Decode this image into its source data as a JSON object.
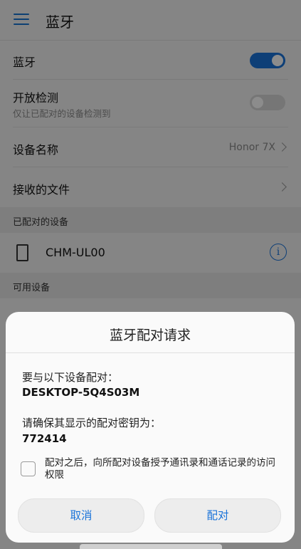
{
  "header": {
    "title": "蓝牙"
  },
  "settings": {
    "bluetooth": {
      "label": "蓝牙",
      "enabled": true
    },
    "discoverable": {
      "label": "开放检测",
      "subtitle": "仅让已配对的设备检测到",
      "enabled": false
    },
    "device_name": {
      "label": "设备名称",
      "value": "Honor 7X"
    },
    "received_files": {
      "label": "接收的文件"
    }
  },
  "paired_devices": {
    "header": "已配对的设备",
    "items": [
      {
        "name": "CHM-UL00"
      }
    ]
  },
  "available_devices": {
    "header": "可用设备"
  },
  "dialog": {
    "title": "蓝牙配对请求",
    "pair_with_label": "要与以下设备配对：",
    "device_name": "DESKTOP-5Q4S03M",
    "confirm_key_label": "请确保其显示的配对密钥为：",
    "pairing_key": "772414",
    "checkbox_label": "配对之后，向所配对设备授予通讯录和通话记录的访问权限",
    "checkbox_checked": false,
    "cancel_label": "取消",
    "pair_label": "配对"
  },
  "colors": {
    "accent": "#1a73d9"
  }
}
